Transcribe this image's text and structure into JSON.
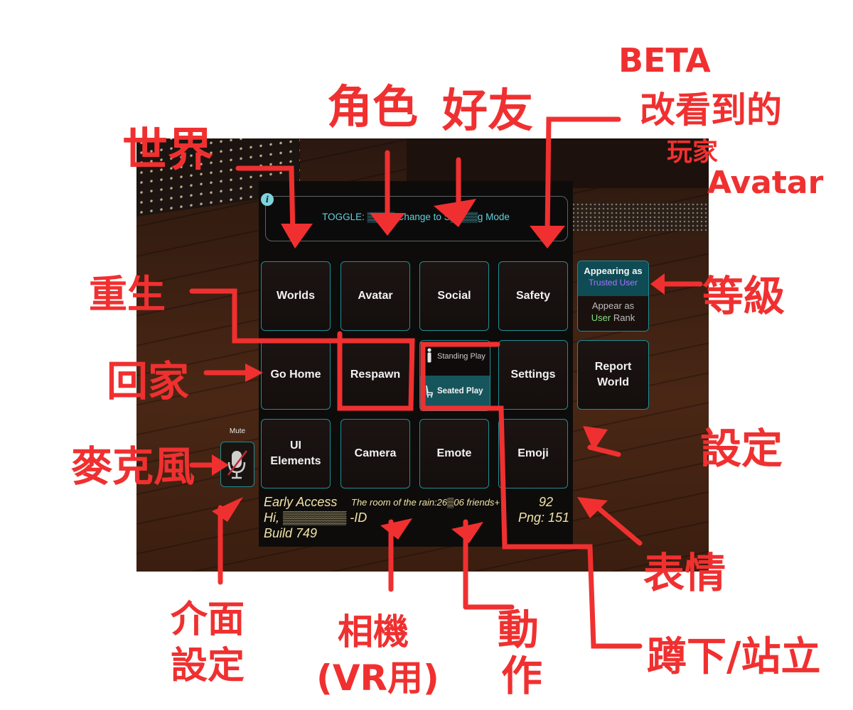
{
  "menu": {
    "info_icon": "i",
    "toggle_text": "TOGGLE: ▒▒▒▒ Change to S▒▒▒▒g Mode",
    "tiles": {
      "worlds": "Worlds",
      "avatar": "Avatar",
      "social": "Social",
      "safety": "Safety",
      "go_home": "Go Home",
      "respawn": "Respawn",
      "settings": "Settings",
      "ui_elements_line1": "UI",
      "ui_elements_line2": "Elements",
      "camera": "Camera",
      "emote": "Emote",
      "emoji": "Emoji"
    },
    "play_mode": {
      "standing": "Standing Play",
      "seated": "Seated Play",
      "selected": "Seated Play"
    },
    "rank": {
      "appearing_as": "Appearing as",
      "current_rank": "Trusted User",
      "appear_as": "Appear as",
      "option_rank": "User",
      "option_suffix": "Rank"
    },
    "report_world_line1": "Report",
    "report_world_line2": "World",
    "mute": {
      "label": "Mute",
      "icon": "mic-muted-icon"
    },
    "status": {
      "early_access": "Early Access",
      "room_info": "The room of the rain:26▒06 friends+",
      "count": "92",
      "greeting": "Hi, ▒▒▒▒▒▒▒ -ID",
      "ping": "Png: 151",
      "build": "Build 749"
    }
  },
  "annotations": {
    "worlds": "世界",
    "avatar": "角色",
    "social": "好友",
    "safety_beta": "BETA",
    "safety_line1": "改看到的",
    "safety_line2": "玩家",
    "safety_line3": "Avatar",
    "rank": "等級",
    "respawn": "重生",
    "go_home": "回家",
    "mic": "麥克風",
    "settings": "設定",
    "emoji": "表情",
    "ui_line1": "介面",
    "ui_line2": "設定",
    "camera_line1": "相機",
    "camera_line2": "(VR用)",
    "emote_line1": "動",
    "emote_line2": "作",
    "play_mode": "蹲下/站立"
  },
  "colors": {
    "accent_teal": "#1f8d95",
    "toggle_text": "#5fd1dd",
    "trusted_user": "#a872ff",
    "user_rank": "#7fe07f",
    "status_text": "#f1e3a8",
    "annotation_red": "#f03030"
  }
}
